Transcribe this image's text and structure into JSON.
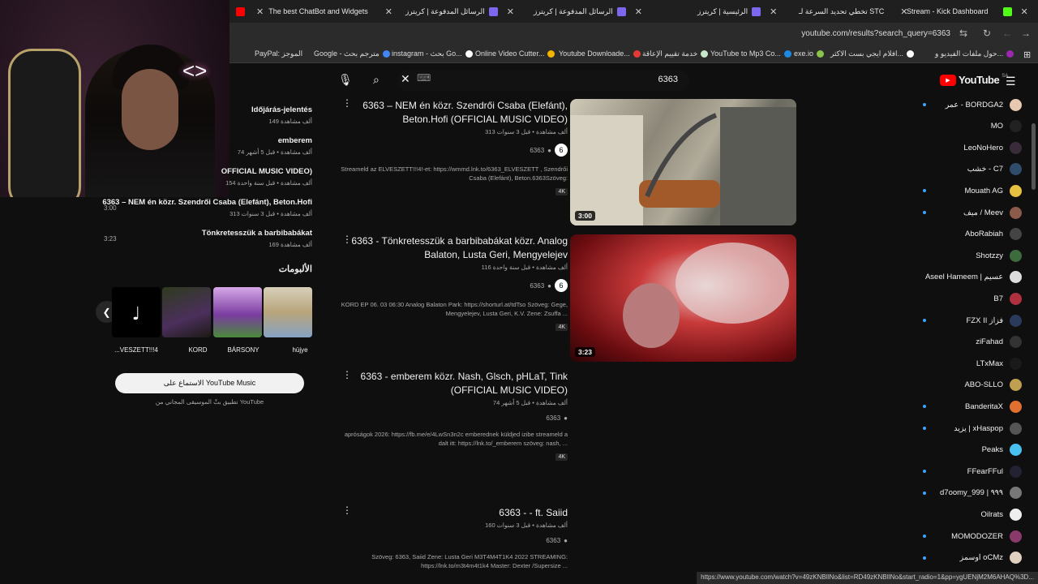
{
  "browser": {
    "tabs": [
      {
        "title": "The best ChatBot and Widgets",
        "color": "#e8e8e8"
      },
      {
        "title": "الرسائل المدفوعة | كريترز",
        "color": "#7b68ee"
      },
      {
        "title": "الرسائل المدفوعة | كريترز",
        "color": "#7b68ee"
      },
      {
        "title": "الرئيسية | كريترز",
        "color": "#7b68ee"
      },
      {
        "title": "تخطي تحديد السرعة لـ STC",
        "color": "#ffffff"
      },
      {
        "title": "Stream - Kick Dashboard",
        "color": "#53fc18"
      }
    ],
    "url": "youtube.com/results?search_query=6363",
    "bookmarks": [
      "PayPal: الموجز",
      "Google - مترجم بحث",
      "instagram - بحث Go...",
      "Online Video Cutter...",
      "Youtube Downloade...",
      "خدمة تقييم الإعاقة",
      "YouTube to Mp3 Co...",
      "exe.io",
      "افلام ايجي بست الاكثر...",
      "حول ملفات الفيديو و..."
    ],
    "status_url": "https://www.youtube.com/watch?v=49zKNBIlNo&list=RD49zKNBIlNo&start_radio=1&pp=ygUENjM2M6AHAQ%3D..."
  },
  "search": {
    "query": "6363"
  },
  "mix_panel": {
    "items": [
      {
        "title": "Időjárás-jelentés",
        "meta": "149 ألف مشاهدة"
      },
      {
        "title": "emberem",
        "meta": "74 ألف مشاهدة • قبل 5 أشهر"
      },
      {
        "title": "OFFICIAL MUSIC VIDEO)",
        "meta": "154 ألف مشاهدة • قبل سنة واحدة"
      },
      {
        "title": "6363 – NEM én közr. Szendrői Csaba (Elefánt), Beton.Hofi",
        "meta": "313 ألف مشاهدة • قبل 3 سنوات",
        "duration": "3:00"
      },
      {
        "title": "Tönkretesszük a barbibabákat",
        "meta": "169 ألف مشاهدة",
        "duration": "3:23"
      }
    ],
    "albums_title": "الألبومات",
    "albums": [
      "...VESZETT!!!4",
      "KORD",
      "BÁRSONY",
      "hüjye"
    ],
    "ytm_button": "الاستماع على YouTube Music",
    "ytm_note": "تطبيق بثّ الموسيقى المجاني من YouTube"
  },
  "results": [
    {
      "title": "6363 – NEM én közr. Szendrői Csaba (Elefánt), Beton.Hofi (OFFICIAL MUSIC VIDEO)",
      "meta": "313 ألف مشاهدة • قبل 3 سنوات",
      "channel": "6363",
      "description": "Streameld az ELVESZETT!!!4!-et: https://wmmd.lnk.to/6363_ELVESZETT , Szendrői Csaba (Elefánt), Beton.6363Szöveg:",
      "badge": "4K",
      "duration": "3:00"
    },
    {
      "title": "6363 - Tönkretesszük a barbibabákat közr. Analog Balaton, Lusta Geri, Mengyelejev",
      "meta": "116 ألف مشاهدة • قبل سنة واحدة",
      "channel": "6363",
      "description": "KORD EP 06. 03 06:30 Analog Balaton Park: https://shorturl.at/tdTso Szöveg: Gege, Mengyelejev, Lusta Geri, K.V. Zene: Zsuffa ...",
      "badge": "4K",
      "duration": "3:23"
    },
    {
      "title": "6363 - emberem közr. Nash, Glsch, pHLaT, Tink (OFFICIAL MUSIC VIDEO)",
      "meta": "74 ألف مشاهدة • قبل 5 أشهر",
      "channel": "6363",
      "description": "apróságok 2026: https://fb.me/e/4LwSn3n2c emberednek küldjed izibe streameld a dalt itt: https://lnk.to/_emberem szöveg: nash, ...",
      "badge": "4K"
    },
    {
      "title": "6363 - - ft. Saiid",
      "meta": "160 ألف مشاهدة • قبل 3 سنوات",
      "channel": "6363",
      "description": "Szöveg: 6363, Saiid Zene: Lusta Geri M3T4M4T1K4 2022 STREAMING: https://lnk.to/m3t4m4t1k4 Master: Dexter /Supersize ..."
    }
  ],
  "sidebar": {
    "logo_word": "YouTube",
    "logo_region": "SA",
    "subscriptions": [
      {
        "name": "عمر - BORDGA2",
        "live": true,
        "color": "#e6c9b0"
      },
      {
        "name": "MO",
        "live": false,
        "color": "#222"
      },
      {
        "name": "LeoNoHero",
        "live": false,
        "color": "#3a2b3b"
      },
      {
        "name": "خشب - C7",
        "live": false,
        "color": "#2f4d6b"
      },
      {
        "name": "Mouath AG",
        "live": true,
        "color": "#e6c040"
      },
      {
        "name": "ميف / Meev",
        "live": true,
        "color": "#8b5a4a"
      },
      {
        "name": "AboRabiah",
        "live": false,
        "color": "#444"
      },
      {
        "name": "Shotzzy",
        "live": false,
        "color": "#3d6b3d"
      },
      {
        "name": "Aseel Hameem | عسيم",
        "live": false,
        "color": "#ddd"
      },
      {
        "name": "B7",
        "live": false,
        "color": "#b03040"
      },
      {
        "name": "FZX II فزاز",
        "live": true,
        "color": "#2a3a5a"
      },
      {
        "name": "ziFahad",
        "live": false,
        "color": "#333"
      },
      {
        "name": "LTxMax",
        "live": false,
        "color": "#1a1a1a"
      },
      {
        "name": "ABO-SLLO",
        "live": false,
        "color": "#c0a050"
      },
      {
        "name": "BanderitaX",
        "live": true,
        "color": "#e07030"
      },
      {
        "name": "يزيد | xHaspop",
        "live": true,
        "color": "#555"
      },
      {
        "name": "Peaks",
        "live": false,
        "color": "#4ac0f0"
      },
      {
        "name": "FFearFFul",
        "live": true,
        "color": "#223"
      },
      {
        "name": "d7oomy_999 | ٩٩٩",
        "live": true,
        "color": "#777"
      },
      {
        "name": "Oilrats",
        "live": false,
        "color": "#eee"
      },
      {
        "name": "MOMODOZER",
        "live": true,
        "color": "#8a3a6a"
      },
      {
        "name": "اوسمز oCMz",
        "live": true,
        "color": "#e0d0c0"
      }
    ]
  }
}
